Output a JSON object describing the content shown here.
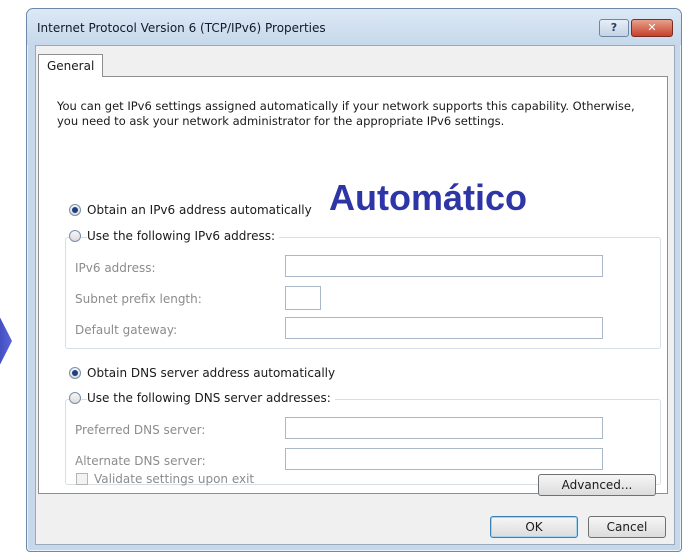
{
  "window": {
    "title": "Internet Protocol Version 6 (TCP/IPv6) Properties",
    "help_label": "?",
    "close_label": "✕"
  },
  "tabs": [
    {
      "label": "General",
      "selected": true
    }
  ],
  "intro_text": "You can get IPv6 settings assigned automatically if your network supports this capability. Otherwise, you need to ask your network administrator for the appropriate IPv6 settings.",
  "overlay_text": "Automático",
  "ip": {
    "auto_label": "Obtain an IPv6 address automatically",
    "manual_label": "Use the following IPv6 address:",
    "selected": "auto",
    "fields": [
      {
        "label": "IPv6 address:",
        "value": ""
      },
      {
        "label": "Subnet prefix length:",
        "value": ""
      },
      {
        "label": "Default gateway:",
        "value": ""
      }
    ]
  },
  "dns": {
    "auto_label": "Obtain DNS server address automatically",
    "manual_label": "Use the following DNS server addresses:",
    "selected": "auto",
    "fields": [
      {
        "label": "Preferred DNS server:",
        "value": ""
      },
      {
        "label": "Alternate DNS server:",
        "value": ""
      }
    ]
  },
  "validate_label": "Validate settings upon exit",
  "advanced_label": "Advanced...",
  "ok_label": "OK",
  "cancel_label": "Cancel",
  "colors": {
    "accent": "#2e35a6",
    "window_frame": "#c6d8ea"
  }
}
